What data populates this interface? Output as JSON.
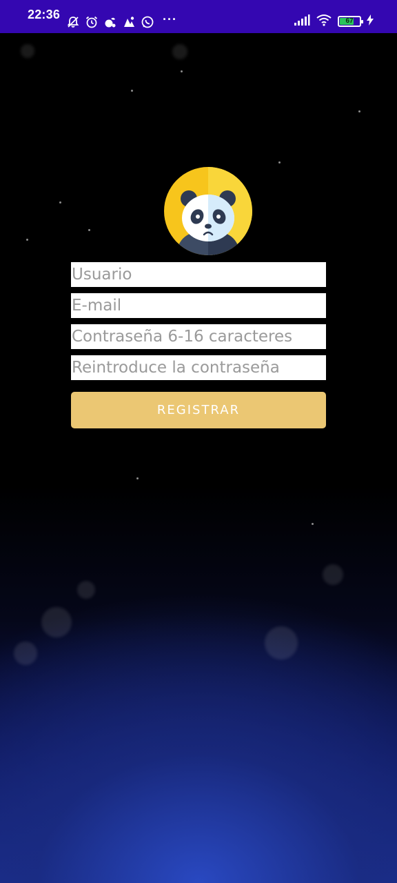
{
  "status_bar": {
    "time": "22:36",
    "more": "···",
    "battery_level": "67",
    "left_icons": [
      "notifications-off-icon",
      "alarm-icon",
      "app-notification-icon",
      "app-notification-icon",
      "whatsapp-icon"
    ],
    "right_icons": [
      "signal-icon",
      "wifi-icon",
      "battery-icon",
      "charging-icon"
    ]
  },
  "logo": {
    "icon": "panda-logo"
  },
  "form": {
    "username_placeholder": "Usuario",
    "email_placeholder": "E-mail",
    "password_placeholder": "Contraseña 6-16 caracteres",
    "password_confirm_placeholder": "Reintroduce la contraseña",
    "register_label": "REGISTRAR"
  },
  "colors": {
    "status_bar": "#3407b1",
    "button": "#ebc773",
    "logo_background": "#f7c51c"
  }
}
